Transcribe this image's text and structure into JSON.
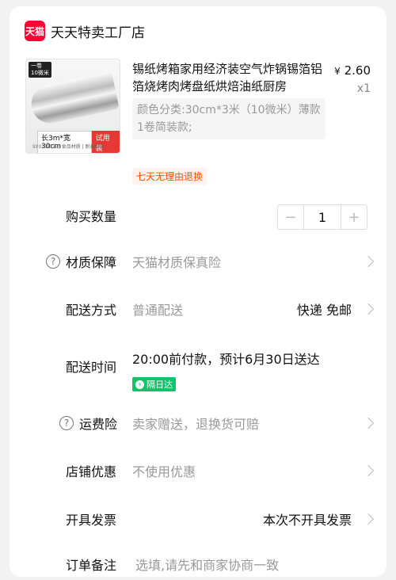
{
  "store": {
    "logo_text": "天猫",
    "name": "天天特卖工厂店"
  },
  "product": {
    "title": "锡纸烤箱家用经济装空气炸锅锡箔铝箔烧烤肉烤盘纸烘焙油纸厨房",
    "price_symbol": "¥",
    "price": "2.60",
    "quantity_label": "x1",
    "spec": "颜色分类:30cm*3米（10微米）薄款1卷简装款;",
    "return_badge": "七天无理由退换",
    "thumb": {
      "corner_tag": "一卷\n10微米",
      "size_text": "长3m*宽30cm",
      "trial_text": "试用装",
      "fine_print": "SY011铝箔 | 食品材质 | 耐高耐低"
    }
  },
  "rows": {
    "quantity": {
      "label": "购买数量",
      "minus": "−",
      "value": "1",
      "plus": "+"
    },
    "material": {
      "help_icon": "?",
      "label": "材质保障",
      "value": "天猫材质保真险"
    },
    "shipping": {
      "label": "配送方式",
      "value": "普通配送",
      "right": "快递 免邮"
    },
    "delivery_time": {
      "label": "配送时间",
      "value": "20:00前付款，预计6月30日送达",
      "tag": "隔日达"
    },
    "freight_insurance": {
      "help_icon": "?",
      "label": "运费险",
      "value": "卖家赠送，退换货可赔"
    },
    "shop_discount": {
      "label": "店铺优惠",
      "value": "不使用优惠"
    },
    "invoice": {
      "label": "开具发票",
      "right": "本次不开具发票"
    },
    "note": {
      "label": "订单备注",
      "placeholder": "选填,请先和商家协商一致"
    }
  }
}
